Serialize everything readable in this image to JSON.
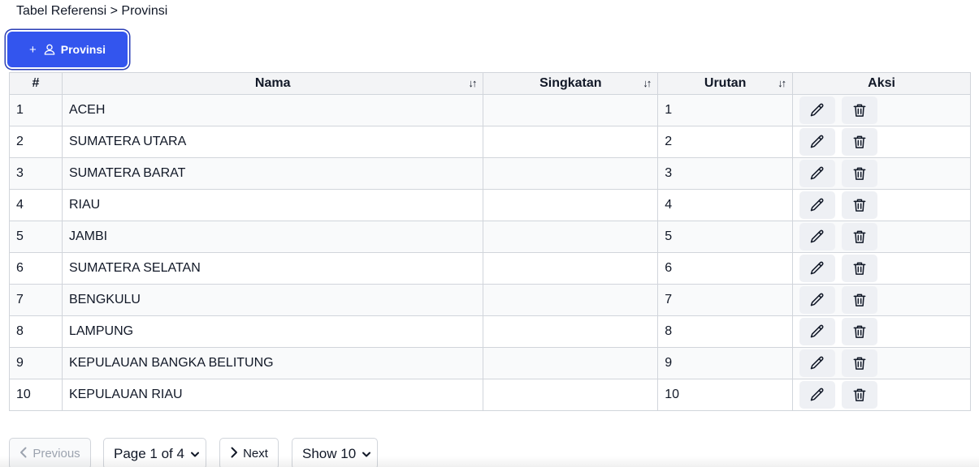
{
  "breadcrumb": "Tabel Referensi > Provinsi",
  "add_button": {
    "plus": "+",
    "label": "Provinsi",
    "icon": "user-icon"
  },
  "table": {
    "headers": {
      "num": "#",
      "nama": "Nama",
      "singkatan": "Singkatan",
      "urutan": "Urutan",
      "aksi": "Aksi"
    },
    "sort_glyph": "↓↑",
    "rows": [
      {
        "num": "1",
        "nama": "ACEH",
        "singkatan": "",
        "urutan": "1"
      },
      {
        "num": "2",
        "nama": "SUMATERA UTARA",
        "singkatan": "",
        "urutan": "2"
      },
      {
        "num": "3",
        "nama": "SUMATERA BARAT",
        "singkatan": "",
        "urutan": "3"
      },
      {
        "num": "4",
        "nama": "RIAU",
        "singkatan": "",
        "urutan": "4"
      },
      {
        "num": "5",
        "nama": "JAMBI",
        "singkatan": "",
        "urutan": "5"
      },
      {
        "num": "6",
        "nama": "SUMATERA SELATAN",
        "singkatan": "",
        "urutan": "6"
      },
      {
        "num": "7",
        "nama": "BENGKULU",
        "singkatan": "",
        "urutan": "7"
      },
      {
        "num": "8",
        "nama": "LAMPUNG",
        "singkatan": "",
        "urutan": "8"
      },
      {
        "num": "9",
        "nama": "KEPULAUAN BANGKA BELITUNG",
        "singkatan": "",
        "urutan": "9"
      },
      {
        "num": "10",
        "nama": "KEPULAUAN RIAU",
        "singkatan": "",
        "urutan": "10"
      }
    ],
    "row_actions": {
      "edit_icon": "pencil-icon",
      "delete_icon": "trash-icon"
    }
  },
  "pagination": {
    "previous_label": "Previous",
    "page_label": "Page 1 of 4",
    "next_label": "Next",
    "show_label": "Show 10"
  },
  "colors": {
    "primary": "#3355ee",
    "header_bg": "#f3f4f6",
    "border": "#d1d5db",
    "action_bg": "#eef0f4"
  }
}
